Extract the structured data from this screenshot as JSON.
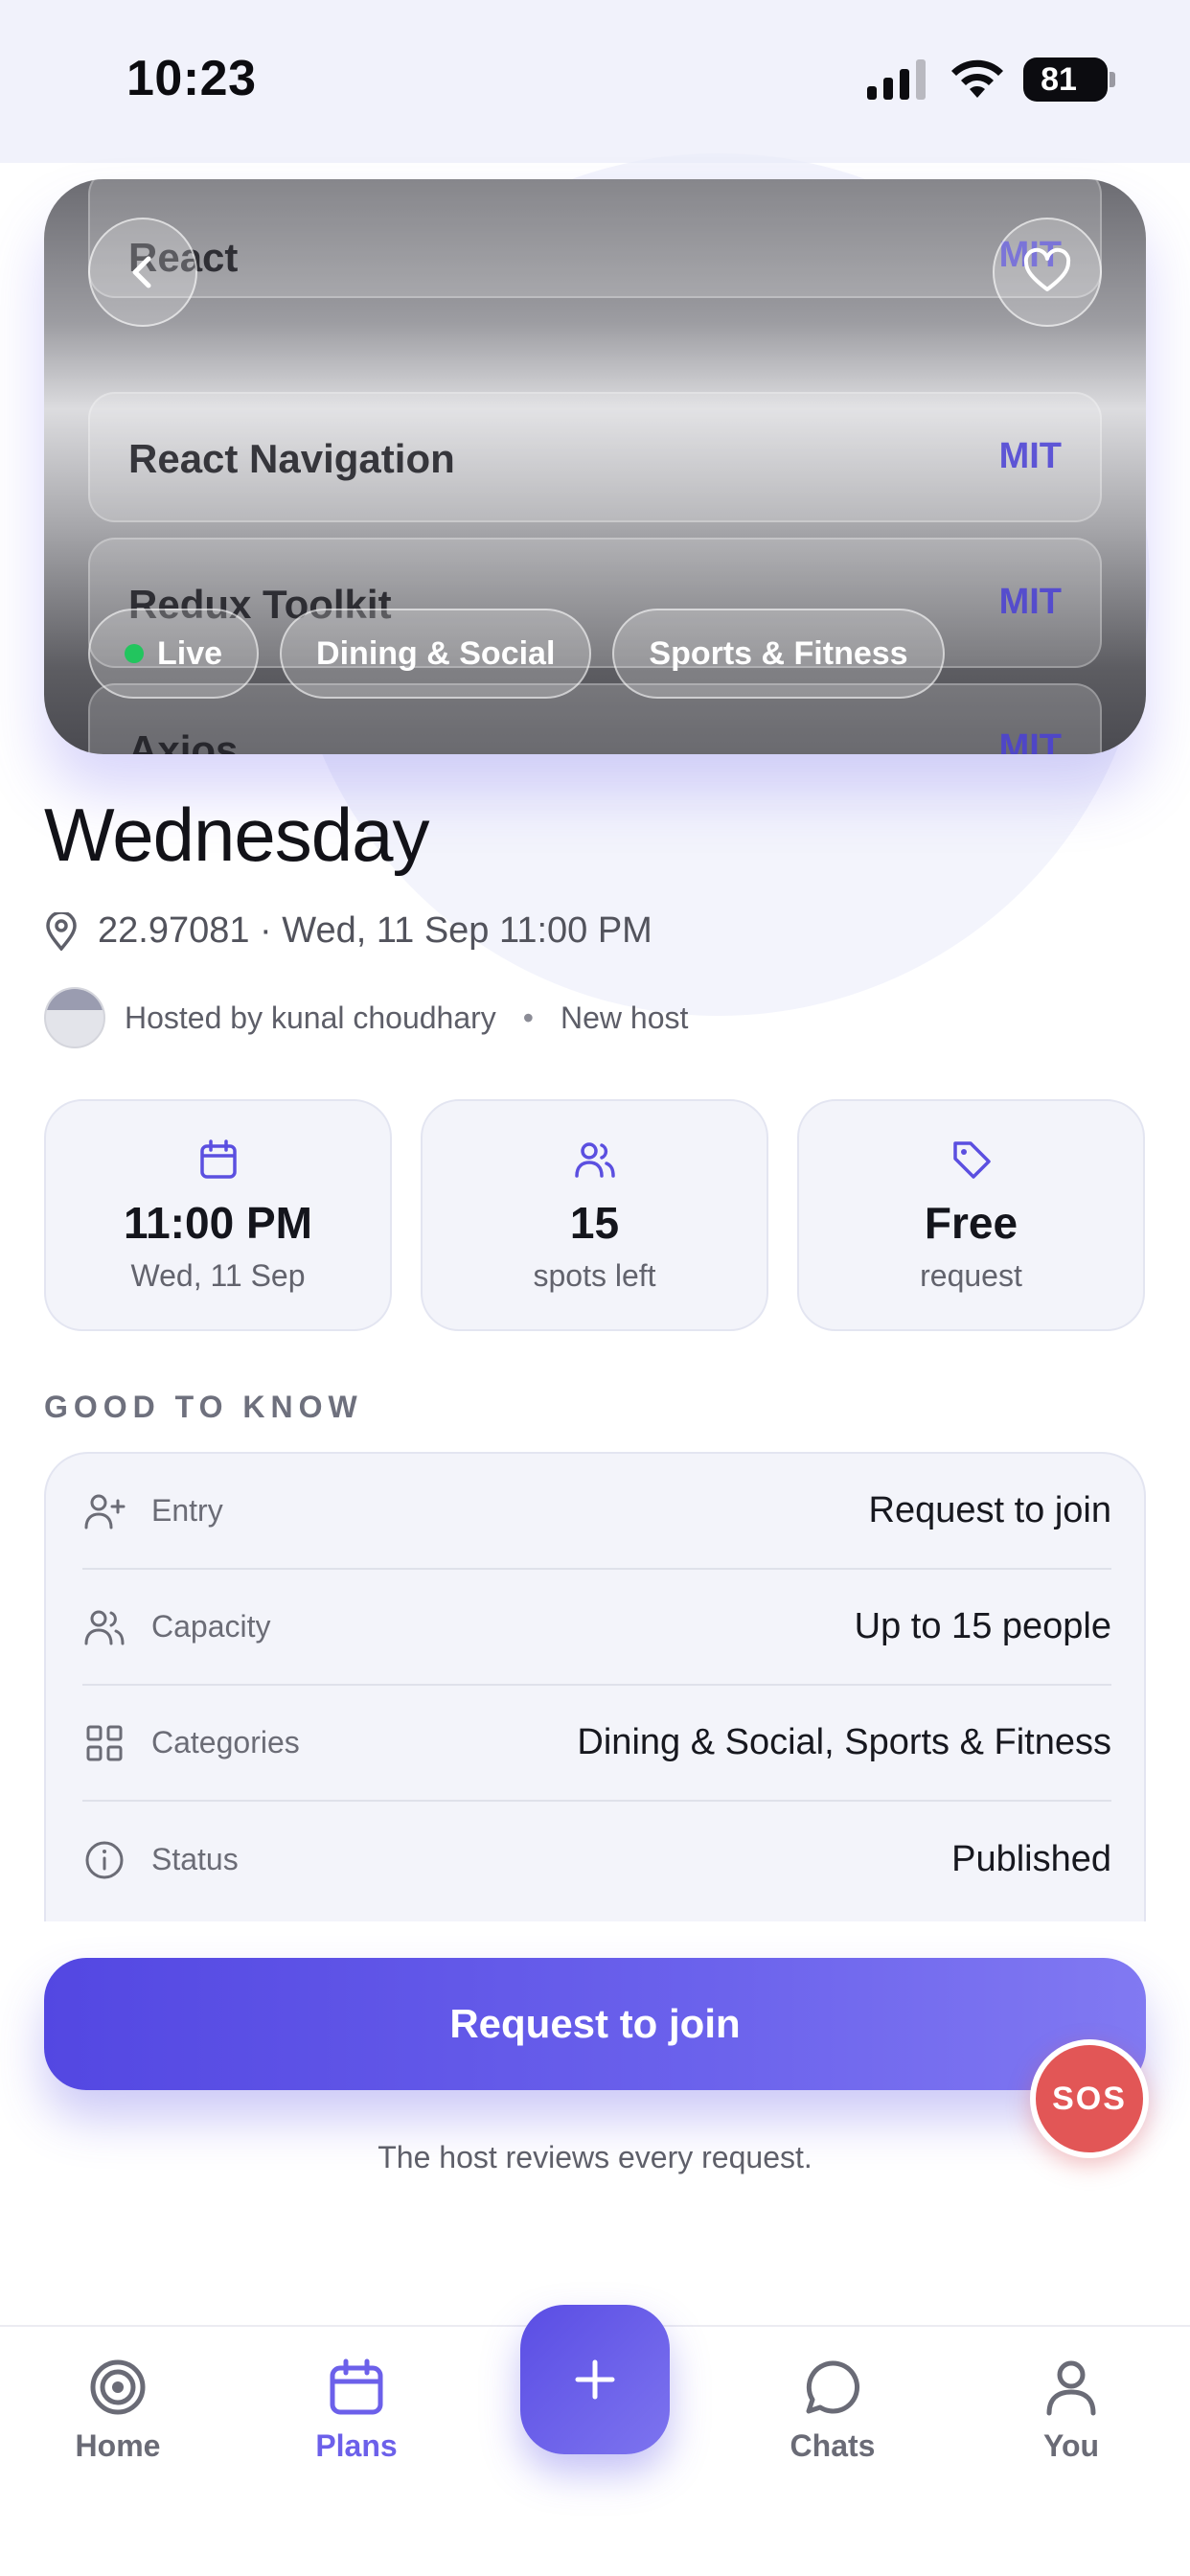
{
  "status_bar": {
    "time": "10:23",
    "battery": "81"
  },
  "hero": {
    "packages": [
      {
        "name": "React",
        "license": "MIT"
      },
      {
        "name": "React Navigation",
        "license": "MIT"
      },
      {
        "name": "Redux Toolkit",
        "license": "MIT"
      },
      {
        "name": "Axios",
        "license": "MIT"
      }
    ],
    "chips": [
      {
        "label": "Live"
      },
      {
        "label": "Dining & Social"
      },
      {
        "label": "Sports & Fitness"
      }
    ]
  },
  "event": {
    "title": "Wednesday",
    "meta": "22.97081 · Wed, 11 Sep 11:00 PM",
    "host": "Hosted by kunal choudhary",
    "host_badge": "New host"
  },
  "stats": [
    {
      "icon": "calendar-icon",
      "value": "11:00 PM",
      "label": "Wed, 11 Sep"
    },
    {
      "icon": "users-icon",
      "value": "15",
      "label": "spots left"
    },
    {
      "icon": "tag-icon",
      "value": "Free",
      "label": "request"
    }
  ],
  "good_to_know": {
    "title": "GOOD TO KNOW",
    "rows": [
      {
        "icon": "user-plus-icon",
        "label": "Entry",
        "value": "Request to join"
      },
      {
        "icon": "users-icon",
        "label": "Capacity",
        "value": "Up to 15 people"
      },
      {
        "icon": "grid-icon",
        "label": "Categories",
        "value": "Dining & Social, Sports & Fitness"
      },
      {
        "icon": "info-icon",
        "label": "Status",
        "value": "Published"
      }
    ]
  },
  "cta": {
    "label": "Request to join",
    "note": "The host reviews every request."
  },
  "sos": {
    "label": "SOS"
  },
  "tabbar": {
    "tabs": [
      {
        "label": "Home",
        "icon": "target-icon"
      },
      {
        "label": "Plans",
        "icon": "calendar-icon"
      },
      {
        "label": "Chats",
        "icon": "chat-icon"
      },
      {
        "label": "You",
        "icon": "person-icon"
      }
    ],
    "active_tab": "Plans"
  },
  "colors": {
    "accent": "#6c60ea",
    "sos": "#e25656",
    "live": "#22c55e"
  }
}
